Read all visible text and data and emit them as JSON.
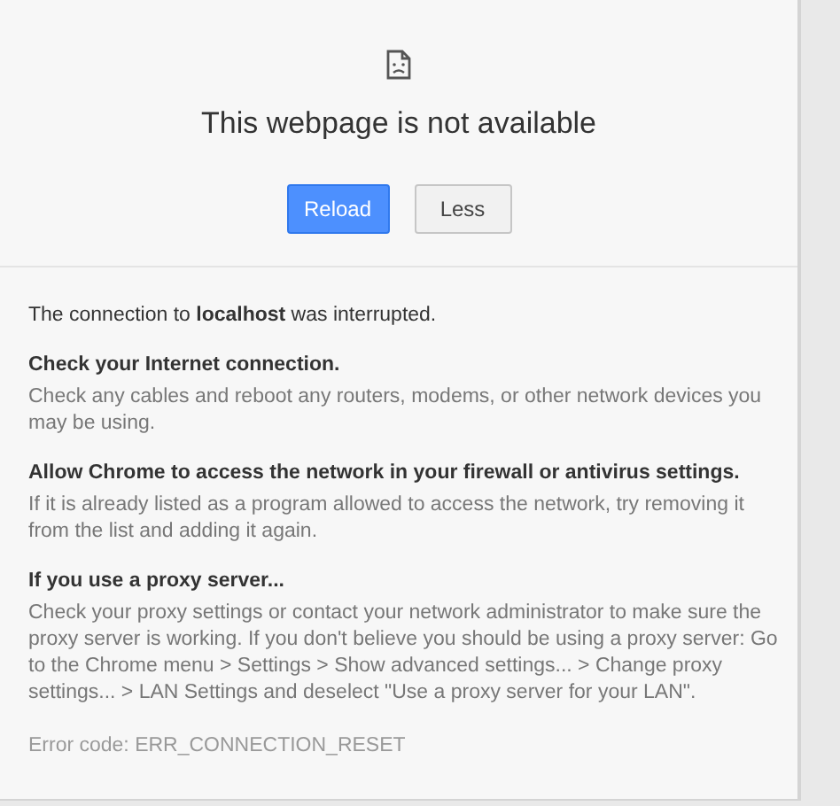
{
  "title": "This webpage is not available",
  "buttons": [
    {
      "label": "Reload",
      "kind": "primary"
    },
    {
      "label": "Less",
      "kind": "secondary"
    }
  ],
  "intro": "The connection to **localhost** was interrupted.",
  "sections": [
    {
      "heading": "Check your Internet connection.",
      "body": "Check any cables and reboot any routers, modems, or other network devices you may be using."
    },
    {
      "heading": "Allow Chrome to access the network in your firewall or antivirus settings.",
      "body": "If it is already listed as a program allowed to access the network, try removing it from the list and adding it again."
    },
    {
      "heading": "If you use a proxy server...",
      "body": "Check your proxy settings or contact your network administrator to make sure the proxy server is working. If you don't believe you should be using a proxy server: Go to the Chrome menu > Settings > Show advanced settings... > Change proxy settings... > LAN Settings and deselect \"Use a proxy server for your LAN\"."
    }
  ],
  "error_code": "Error code: ERR_CONNECTION_RESET"
}
